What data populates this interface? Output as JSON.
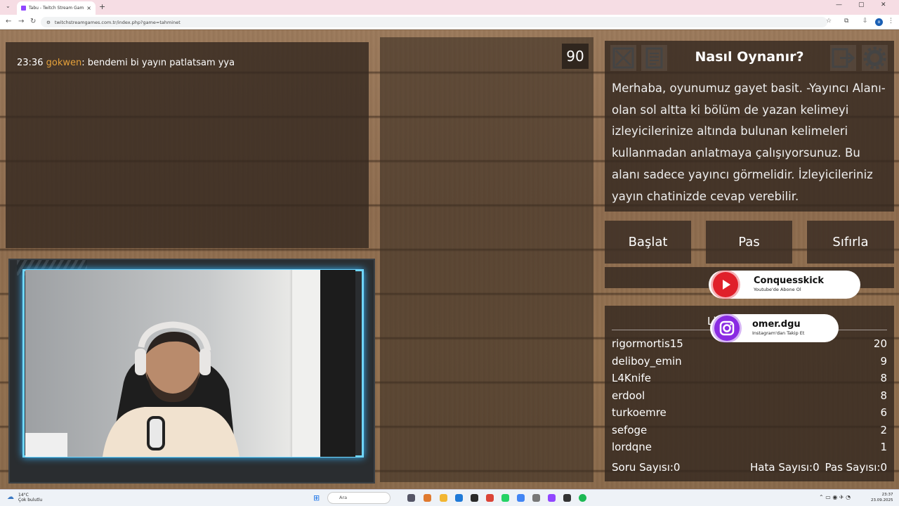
{
  "browser": {
    "tab_title": "Tabu - Twitch Stream Games",
    "tab_close": "×",
    "new_tab": "+",
    "url": "twitchstreamgames.com.tr/index.php?game=tahminet"
  },
  "chat": {
    "time": "23:36",
    "user": "gokwen",
    "message": ": bendemi bi yayın patlatsam yya"
  },
  "timer": "90",
  "howto": {
    "title": "Nasıl Oynanır?",
    "text": "Merhaba, oyunumuz gayet basit. -Yayıncı Alanı- olan sol altta ki bölüm de yazan kelimeyi izleyicilerinize altında bulunan kelimeleri kullanmadan anlatmaya çalışıyorsunuz. Bu alanı sadece yayıncı görmelidir. İzleyicileriniz yayın chatinizde cevap verebilir."
  },
  "buttons": {
    "start": "Başlat",
    "pass": "Pas",
    "reset": "Sıfırla"
  },
  "social": {
    "youtube_name": "Conquesskick",
    "youtube_sub": "Youtube'de Abone Ol",
    "instagram_name": "omer.dgu",
    "instagram_sub": "Instagram'dan Takip Et"
  },
  "scoreboard": {
    "header_fragment": "Li",
    "players": [
      {
        "name": "rigormortis15",
        "score": "20"
      },
      {
        "name": "deliboy_emin",
        "score": "9"
      },
      {
        "name": "L4Knife",
        "score": "8"
      },
      {
        "name": "erdool",
        "score": "8"
      },
      {
        "name": "turkoemre",
        "score": "6"
      },
      {
        "name": "sefoge",
        "score": "2"
      },
      {
        "name": "lordqne",
        "score": "1"
      }
    ],
    "question_count": "Soru Sayısı:0",
    "error_count": "Hata Sayısı:0",
    "pass_count": "Pas Sayısı:0"
  },
  "taskbar": {
    "weather_temp": "14°C",
    "weather_desc": "Çok bulutlu",
    "search_placeholder": "Ara",
    "time": "23:37",
    "date": "23.09.2025"
  },
  "colors": {
    "chat_user": "#e5a13a",
    "youtube_red": "#e0202a",
    "instagram_purple": "#8a2be2",
    "cam_glow": "#6fd6ff"
  }
}
